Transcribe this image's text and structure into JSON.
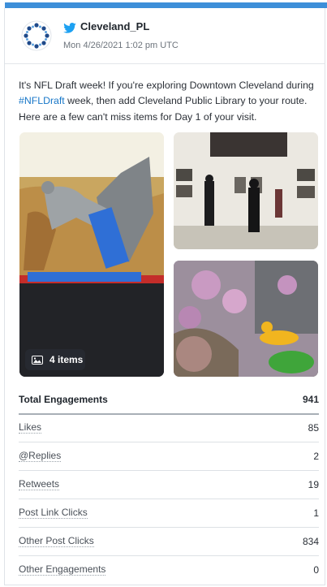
{
  "account": {
    "handle": "Cleveland_PL",
    "date": "Mon 4/26/2021 1:02 pm UTC"
  },
  "post": {
    "text_before": "It's NFL Draft week! If you're exploring Downtown Cleveland during ",
    "hashtag": "#NFLDraft",
    "text_after": " week, then add Cleveland Public Library to your route. Here are a few can't miss items for Day 1 of your visit."
  },
  "media": {
    "items_label": "4 items"
  },
  "metrics": {
    "total": {
      "label": "Total Engagements",
      "value": "941"
    },
    "rows": [
      {
        "label": "Likes",
        "value": "85"
      },
      {
        "label": "@Replies",
        "value": "2"
      },
      {
        "label": "Retweets",
        "value": "19"
      },
      {
        "label": "Post Link Clicks",
        "value": "1"
      },
      {
        "label": "Other Post Clicks",
        "value": "834"
      },
      {
        "label": "Other Engagements",
        "value": "0"
      }
    ]
  },
  "colors": {
    "accent": "#3d8fd9",
    "twitter_blue": "#1da1f2",
    "hashtag": "#1877c8"
  }
}
